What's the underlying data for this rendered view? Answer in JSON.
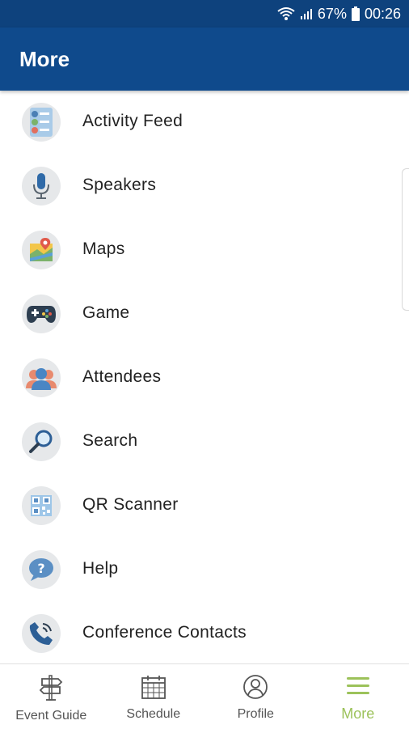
{
  "status_bar": {
    "battery": "67%",
    "time": "00:26",
    "icons": [
      "wifi-icon",
      "signal-icon",
      "battery-icon"
    ]
  },
  "app_bar": {
    "title": "More"
  },
  "menu": {
    "items": [
      {
        "label": "Activity Feed",
        "icon": "activity-feed-icon"
      },
      {
        "label": "Speakers",
        "icon": "microphone-icon"
      },
      {
        "label": "Maps",
        "icon": "map-icon"
      },
      {
        "label": "Game",
        "icon": "gamepad-icon"
      },
      {
        "label": "Attendees",
        "icon": "attendees-icon"
      },
      {
        "label": "Search",
        "icon": "search-icon"
      },
      {
        "label": "QR Scanner",
        "icon": "qr-code-icon"
      },
      {
        "label": "Help",
        "icon": "help-icon"
      },
      {
        "label": "Conference Contacts",
        "icon": "phone-icon"
      }
    ]
  },
  "bottom_nav": {
    "items": [
      {
        "label": "Event Guide",
        "icon": "signpost-icon"
      },
      {
        "label": "Schedule",
        "icon": "calendar-icon"
      },
      {
        "label": "Profile",
        "icon": "profile-icon"
      },
      {
        "label": "More",
        "icon": "hamburger-menu-icon",
        "active": true
      }
    ]
  },
  "colors": {
    "header": "#0f4a8c",
    "status_bar": "#0e427d",
    "active_nav": "#9cc25a",
    "icon_bg": "#e6e8ea"
  }
}
